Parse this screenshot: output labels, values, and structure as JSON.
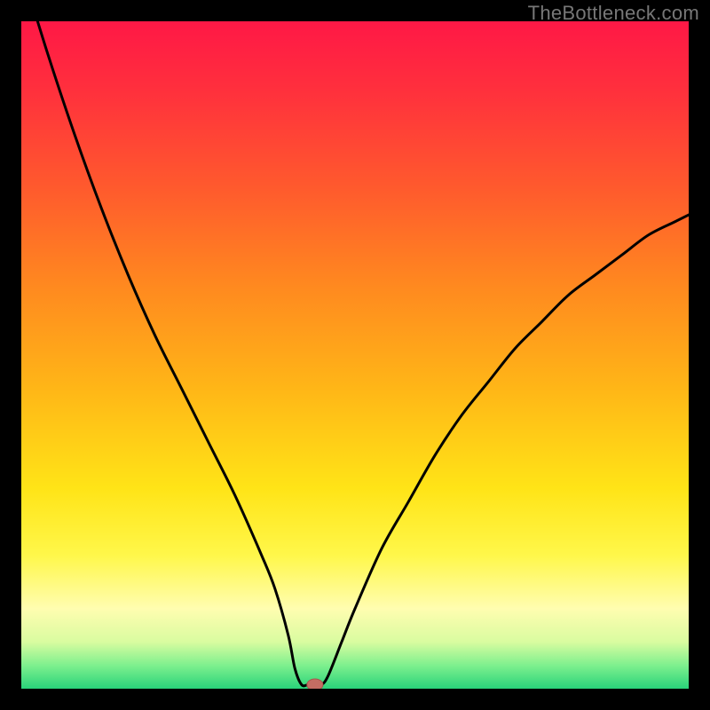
{
  "watermark": "TheBottleneck.com",
  "colors": {
    "gradient_stops": [
      {
        "offset": 0.0,
        "color": "#ff1846"
      },
      {
        "offset": 0.1,
        "color": "#ff2f3d"
      },
      {
        "offset": 0.25,
        "color": "#ff5a2d"
      },
      {
        "offset": 0.4,
        "color": "#ff8a1f"
      },
      {
        "offset": 0.55,
        "color": "#ffb617"
      },
      {
        "offset": 0.7,
        "color": "#ffe417"
      },
      {
        "offset": 0.8,
        "color": "#fff74a"
      },
      {
        "offset": 0.88,
        "color": "#fffdb0"
      },
      {
        "offset": 0.93,
        "color": "#d9fca0"
      },
      {
        "offset": 0.965,
        "color": "#7ef08e"
      },
      {
        "offset": 1.0,
        "color": "#29d37a"
      }
    ],
    "curve": "#000000",
    "marker_fill": "#c46d63",
    "marker_stroke": "#a9564d",
    "frame": "#000000"
  },
  "chart_data": {
    "type": "line",
    "title": "",
    "xlabel": "",
    "ylabel": "",
    "xlim": [
      0,
      100
    ],
    "ylim": [
      0,
      100
    ],
    "legend": false,
    "grid": false,
    "marker": {
      "x": 44,
      "y": 0.6
    },
    "series": [
      {
        "name": "curve",
        "x": [
          0,
          4,
          8,
          12,
          16,
          20,
          24,
          28,
          32,
          36,
          38,
          40,
          41,
          42,
          43,
          44,
          45,
          46,
          48,
          50,
          54,
          58,
          62,
          66,
          70,
          74,
          78,
          82,
          86,
          90,
          94,
          98,
          100
        ],
        "y": [
          108,
          95,
          83,
          72,
          62,
          53,
          45,
          37,
          29,
          20,
          15,
          8,
          3,
          0.6,
          0.6,
          0.6,
          0.6,
          2,
          7,
          12,
          21,
          28,
          35,
          41,
          46,
          51,
          55,
          59,
          62,
          65,
          68,
          70,
          71
        ]
      }
    ]
  }
}
